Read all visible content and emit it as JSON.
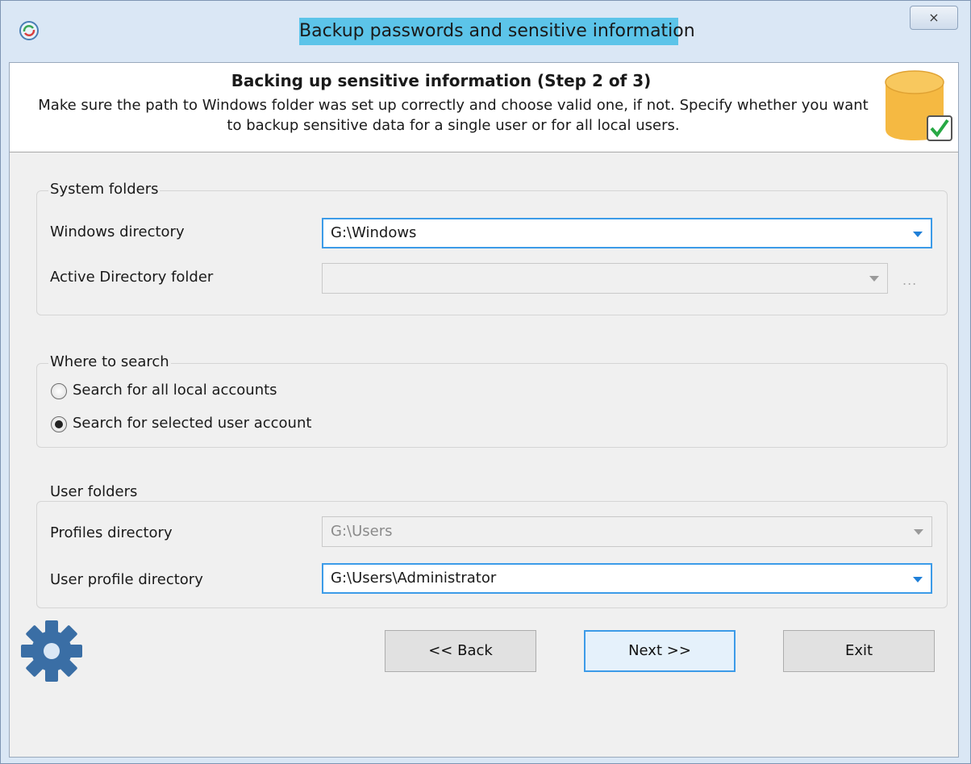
{
  "window": {
    "title": "Backup passwords and sensitive information",
    "close_glyph": "⨯"
  },
  "header": {
    "title": "Backing up sensitive information (Step 2 of 3)",
    "description": "Make sure the path to Windows folder was set up correctly and choose valid one, if not. Specify whether you want to backup sensitive data for a single user or for all local users.",
    "icon": "database-check-icon"
  },
  "system_folders": {
    "title": "System folders",
    "windows_dir_label": "Windows directory",
    "windows_dir_value": "G:\\Windows",
    "ad_folder_label": "Active Directory folder",
    "ad_folder_value": "",
    "ad_browse_label": "..."
  },
  "where_to_search": {
    "title": "Where to search",
    "options": [
      {
        "label": "Search for all local accounts",
        "checked": false
      },
      {
        "label": "Search for selected user account",
        "checked": true
      }
    ]
  },
  "user_folders": {
    "title": "User folders",
    "profiles_dir_label": "Profiles directory",
    "profiles_dir_value": "G:\\Users",
    "user_profile_label": "User profile directory",
    "user_profile_value": "G:\\Users\\Administrator"
  },
  "buttons": {
    "back": "<< Back",
    "next": "Next >>",
    "exit": "Exit"
  },
  "colors": {
    "title_highlight": "#5cc4e9",
    "accent": "#3c9be8",
    "gear": "#3a6ea5",
    "db_icon": "#f5b942"
  }
}
